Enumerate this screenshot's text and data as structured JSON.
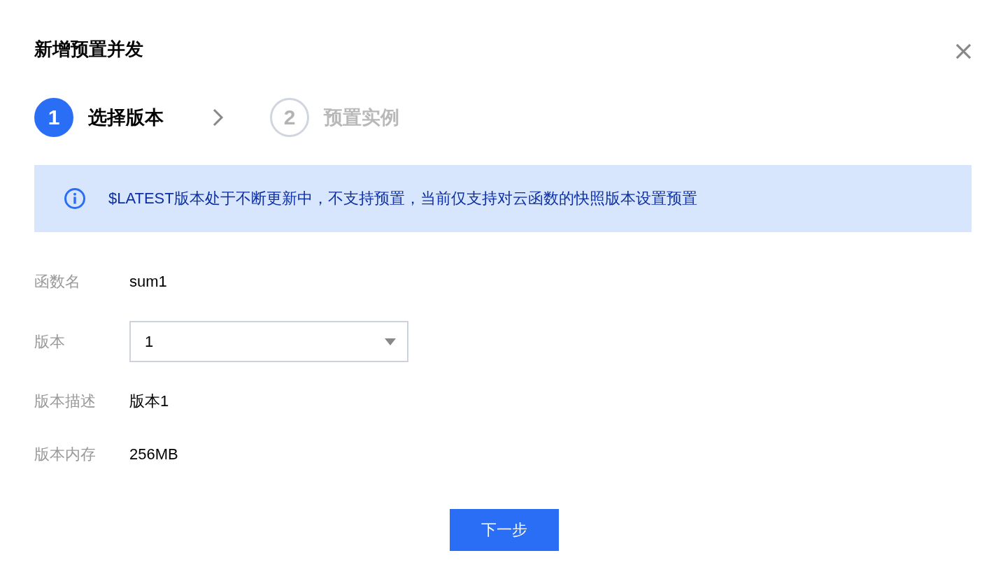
{
  "dialog": {
    "title": "新增预置并发"
  },
  "steps": [
    {
      "number": "1",
      "label": "选择版本",
      "selected": true
    },
    {
      "number": "2",
      "label": "预置实例",
      "selected": false
    }
  ],
  "notice": {
    "text": "$LATEST版本处于不断更新中，不支持预置，当前仅支持对云函数的快照版本设置预置"
  },
  "fields": [
    {
      "label": "函数名",
      "kind": "text",
      "value": "sum1"
    },
    {
      "label": "版本",
      "kind": "select",
      "value": "1"
    },
    {
      "label": "版本描述",
      "kind": "text",
      "value": "版本1"
    },
    {
      "label": "版本内存",
      "kind": "text",
      "value": "256MB"
    }
  ],
  "buttons": [
    {
      "label": "下一步"
    }
  ]
}
